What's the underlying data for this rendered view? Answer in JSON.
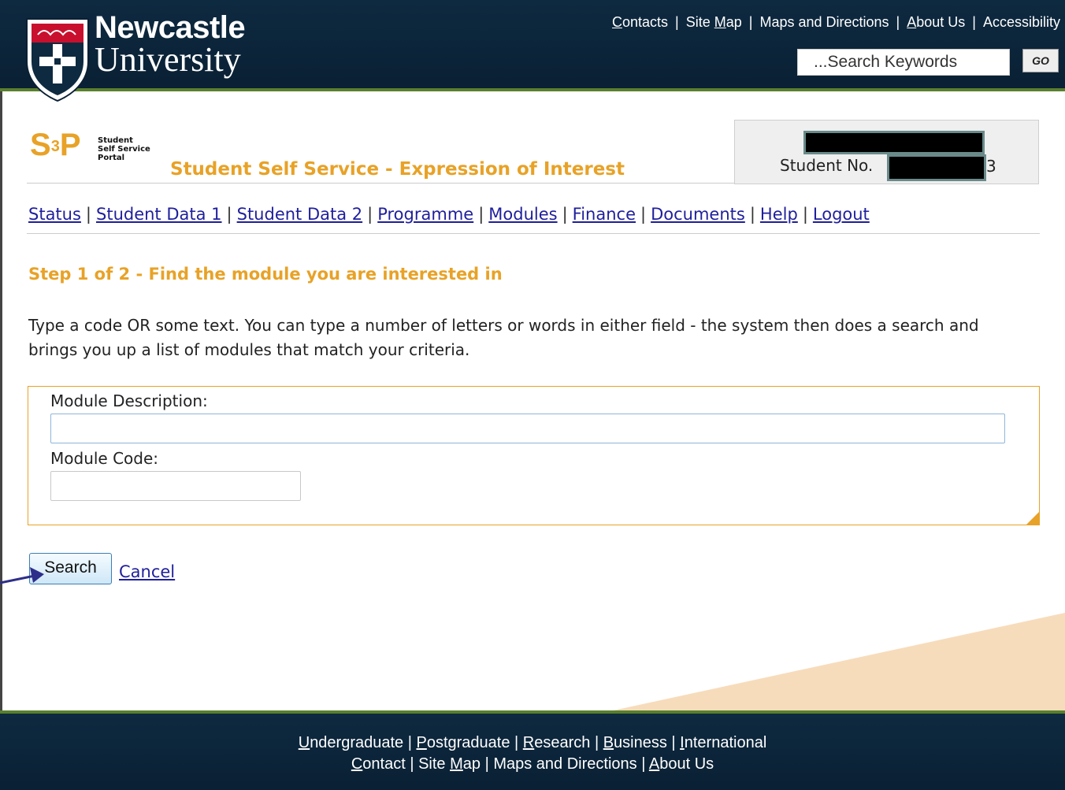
{
  "header": {
    "logo_line1": "Newcastle",
    "logo_line2": "University",
    "top_links": [
      {
        "prefix": "",
        "u": "C",
        "rest": "ontacts"
      },
      {
        "prefix": "Site ",
        "u": "M",
        "rest": "ap"
      },
      {
        "prefix": "Maps and Directions",
        "u": "",
        "rest": ""
      },
      {
        "prefix": "",
        "u": "A",
        "rest": "bout Us"
      },
      {
        "prefix": "Accessibility",
        "u": "",
        "rest": ""
      }
    ],
    "search_placeholder": "...Search Keywords",
    "go_label": "GO"
  },
  "brand": {
    "s3p": "S",
    "s3p_sup": "3",
    "s3p_p": "P",
    "sub1": "Student",
    "sub2": "Self Service",
    "sub3": "Portal",
    "page_heading": "Student Self Service - Expression of Interest"
  },
  "student": {
    "label": "Student No.",
    "tail": "3"
  },
  "nav": [
    "Status",
    "Student Data 1",
    "Student Data 2",
    "Programme",
    "Modules",
    "Finance",
    "Documents",
    "Help",
    "Logout"
  ],
  "step_heading": "Step 1 of 2 - Find the module you are interested in",
  "intro": "Type a code OR some text. You can type a number of letters or words in either field - the system then does a search and brings you up a list of modules that match your criteria.",
  "form": {
    "desc_label": "Module Description:",
    "desc_value": "",
    "code_label": "Module Code:",
    "code_value": ""
  },
  "buttons": {
    "search": "Search",
    "cancel": "Cancel"
  },
  "footer": {
    "row1": [
      {
        "u": "U",
        "rest": "ndergraduate"
      },
      {
        "u": "P",
        "rest": "ostgraduate"
      },
      {
        "u": "R",
        "rest": "esearch"
      },
      {
        "u": "B",
        "rest": "usiness"
      },
      {
        "u": "I",
        "rest": "nternational"
      }
    ],
    "row2": [
      {
        "prefix": "",
        "u": "C",
        "rest": "ontact"
      },
      {
        "prefix": "Site ",
        "u": "M",
        "rest": "ap"
      },
      {
        "prefix": "Maps and Directions",
        "u": "",
        "rest": ""
      },
      {
        "prefix": "",
        "u": "A",
        "rest": "bout Us"
      }
    ]
  },
  "colors": {
    "header_bg": "#0e2a40",
    "accent_orange": "#e8a227",
    "link_blue": "#1f1f9c",
    "header_rule_green": "#5a7f2e"
  }
}
